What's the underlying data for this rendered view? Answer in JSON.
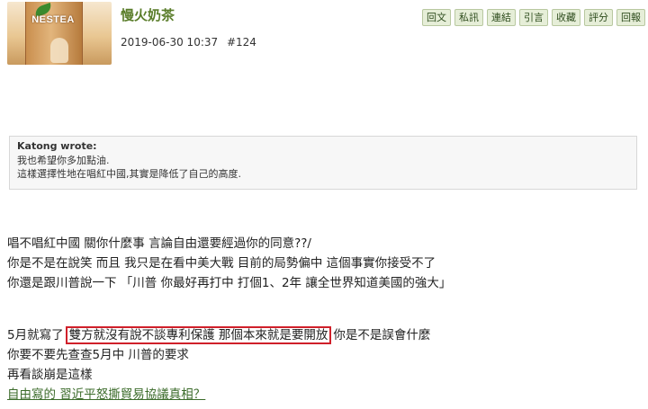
{
  "post": {
    "username": "慢火奶茶",
    "timestamp": "2019-06-30 10:37",
    "post_number": "#124",
    "avatar_text": "NESTEA",
    "actions": [
      "回文",
      "私訊",
      "連結",
      "引言",
      "收藏",
      "評分",
      "回報"
    ]
  },
  "quote": {
    "author": "Katong wrote:",
    "lines": [
      "我也希望你多加點油.",
      "這樣選擇性地在唱紅中國,其實是降低了自己的高度."
    ]
  },
  "body": {
    "p1": [
      "唱不唱紅中國 關你什麼事 言論自由還要經過你的同意??/",
      "你是不是在說笑 而且 我只是在看中美大戰 目前的局勢偏中 這個事實你接受不了",
      "你還是跟川普說一下 「川普 你最好再打中 打個1、2年 讓全世界知道美國的強大」"
    ],
    "p2_before": "5月就寫了",
    "p2_highlight": "雙方就沒有說不談專利保護 那個本來就是要開放",
    "p2_after": "你是不是誤會什麼",
    "p3": "你要不要先查查5月中 川普的要求",
    "p4": "再看談崩是這樣",
    "link": "自由寫的 習近平怒撕貿易協議真相？"
  }
}
